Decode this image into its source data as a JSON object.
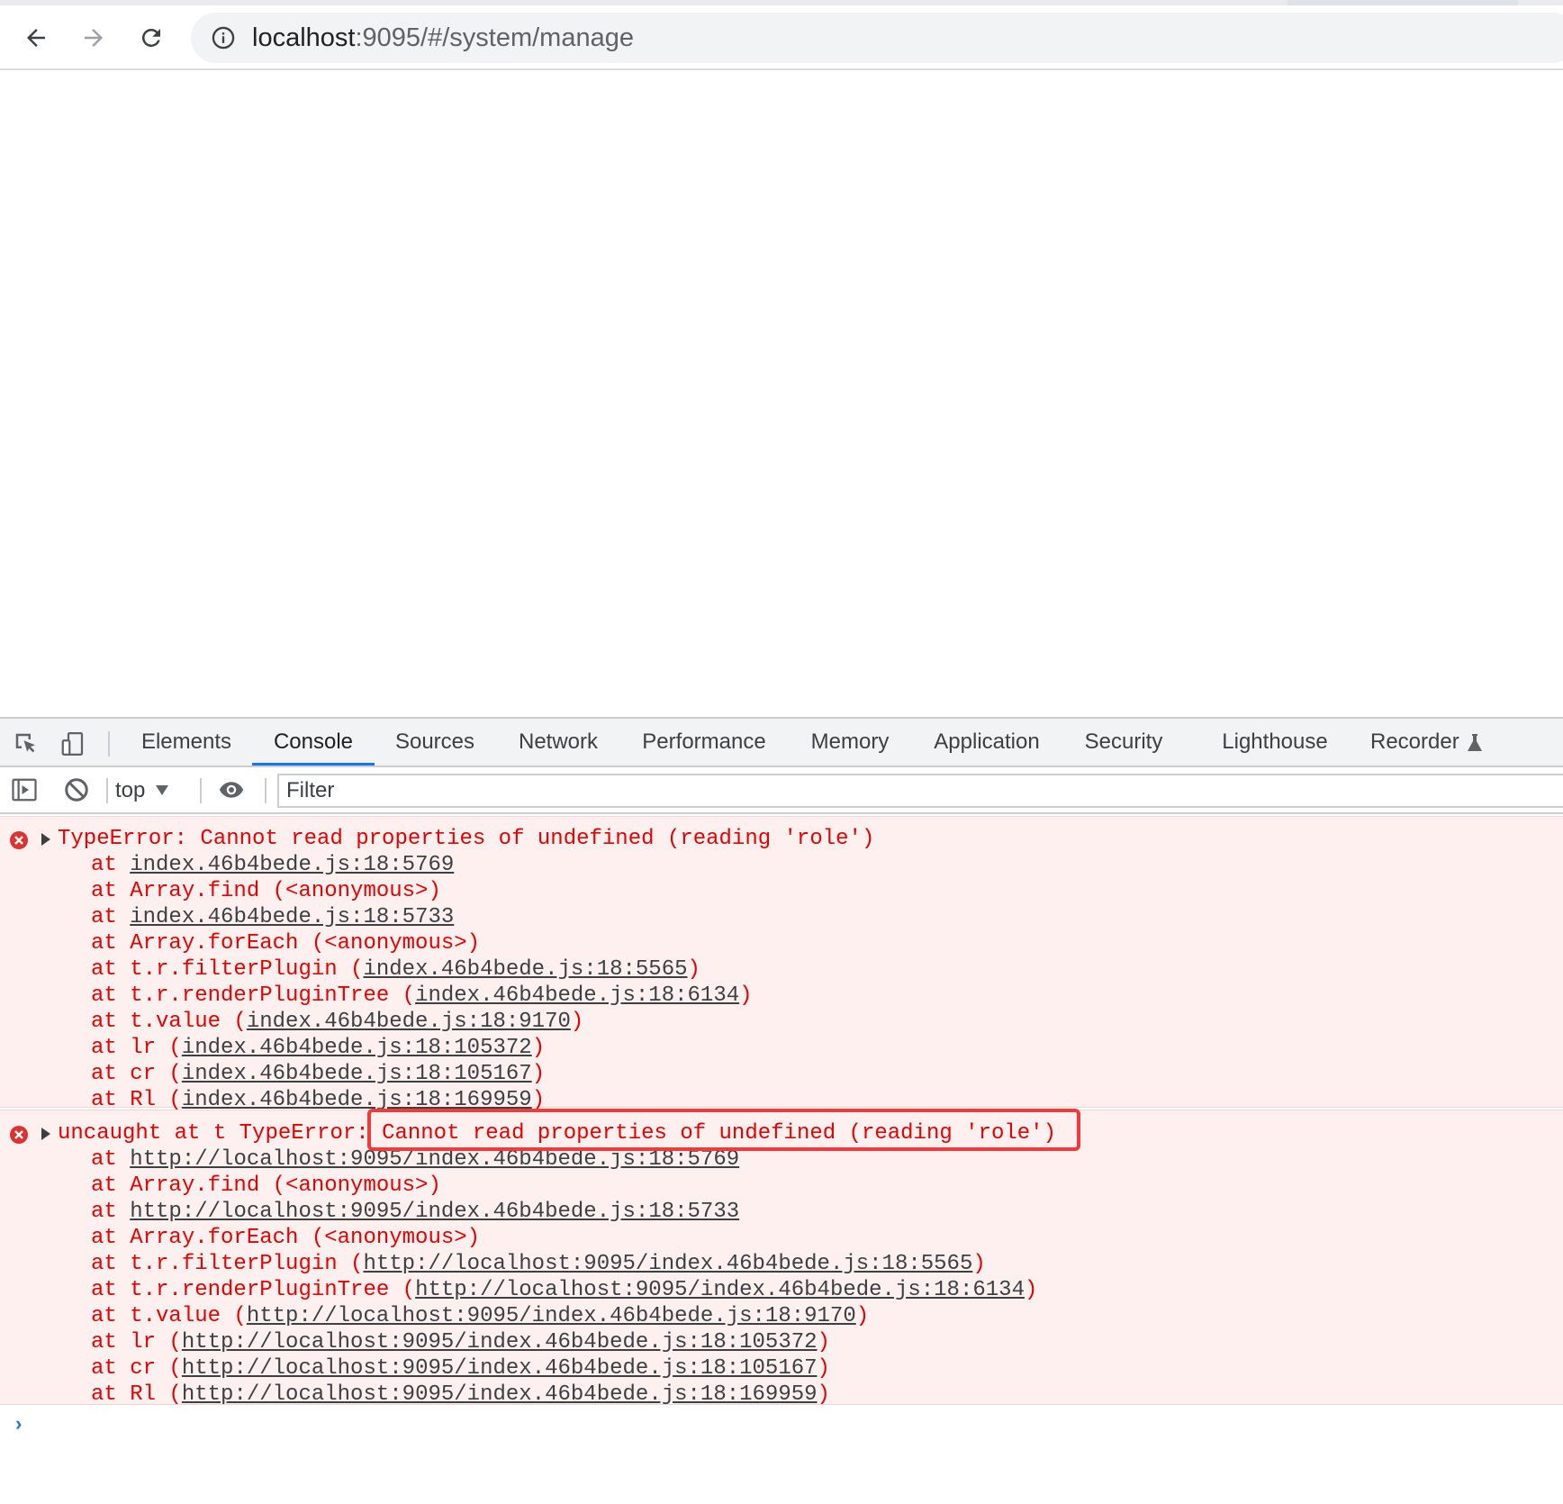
{
  "browser": {
    "url_host": "localhost",
    "url_rest": ":9095/#/system/manage",
    "icons": [
      "back-arrow-icon",
      "forward-arrow-icon",
      "reload-icon",
      "info-icon"
    ]
  },
  "devtools": {
    "tabs": [
      {
        "label": "Elements"
      },
      {
        "label": "Console"
      },
      {
        "label": "Sources"
      },
      {
        "label": "Network"
      },
      {
        "label": "Performance"
      },
      {
        "label": "Memory"
      },
      {
        "label": "Application"
      },
      {
        "label": "Security"
      },
      {
        "label": "Lighthouse"
      },
      {
        "label": "Recorder"
      }
    ],
    "active_tab": "Console",
    "context": "top",
    "filter_placeholder": "Filter",
    "accent_color": "#1a73e8"
  },
  "console": {
    "error_color": "#e50000",
    "messages": [
      {
        "header": "TypeError: Cannot read properties of undefined (reading 'role')",
        "frames": [
          {
            "prefix": "at ",
            "link": "index.46b4bede.js:18:5769",
            "suffix": ""
          },
          {
            "prefix": "at Array.find (<anonymous>)",
            "link": "",
            "suffix": ""
          },
          {
            "prefix": "at ",
            "link": "index.46b4bede.js:18:5733",
            "suffix": ""
          },
          {
            "prefix": "at Array.forEach (<anonymous>)",
            "link": "",
            "suffix": ""
          },
          {
            "prefix": "at t.r.filterPlugin (",
            "link": "index.46b4bede.js:18:5565",
            "suffix": ")"
          },
          {
            "prefix": "at t.r.renderPluginTree (",
            "link": "index.46b4bede.js:18:6134",
            "suffix": ")"
          },
          {
            "prefix": "at t.value (",
            "link": "index.46b4bede.js:18:9170",
            "suffix": ")"
          },
          {
            "prefix": "at lr (",
            "link": "index.46b4bede.js:18:105372",
            "suffix": ")"
          },
          {
            "prefix": "at cr (",
            "link": "index.46b4bede.js:18:105167",
            "suffix": ")"
          },
          {
            "prefix": "at Rl (",
            "link": "index.46b4bede.js:18:169959",
            "suffix": ")"
          }
        ]
      },
      {
        "header_prefix": "uncaught at t TypeError: ",
        "header_highlight": "Cannot read properties of undefined (reading 'role')",
        "frames": [
          {
            "prefix": "at ",
            "link": "http://localhost:9095/index.46b4bede.js:18:5769",
            "suffix": ""
          },
          {
            "prefix": "at Array.find (<anonymous>)",
            "link": "",
            "suffix": ""
          },
          {
            "prefix": "at ",
            "link": "http://localhost:9095/index.46b4bede.js:18:5733",
            "suffix": ""
          },
          {
            "prefix": "at Array.forEach (<anonymous>)",
            "link": "",
            "suffix": ""
          },
          {
            "prefix": "at t.r.filterPlugin (",
            "link": "http://localhost:9095/index.46b4bede.js:18:5565",
            "suffix": ")"
          },
          {
            "prefix": "at t.r.renderPluginTree (",
            "link": "http://localhost:9095/index.46b4bede.js:18:6134",
            "suffix": ")"
          },
          {
            "prefix": "at t.value (",
            "link": "http://localhost:9095/index.46b4bede.js:18:9170",
            "suffix": ")"
          },
          {
            "prefix": "at lr (",
            "link": "http://localhost:9095/index.46b4bede.js:18:105372",
            "suffix": ")"
          },
          {
            "prefix": "at cr (",
            "link": "http://localhost:9095/index.46b4bede.js:18:105167",
            "suffix": ")"
          },
          {
            "prefix": "at Rl (",
            "link": "http://localhost:9095/index.46b4bede.js:18:169959",
            "suffix": ")"
          }
        ]
      }
    ],
    "prompt_symbol": "›"
  }
}
